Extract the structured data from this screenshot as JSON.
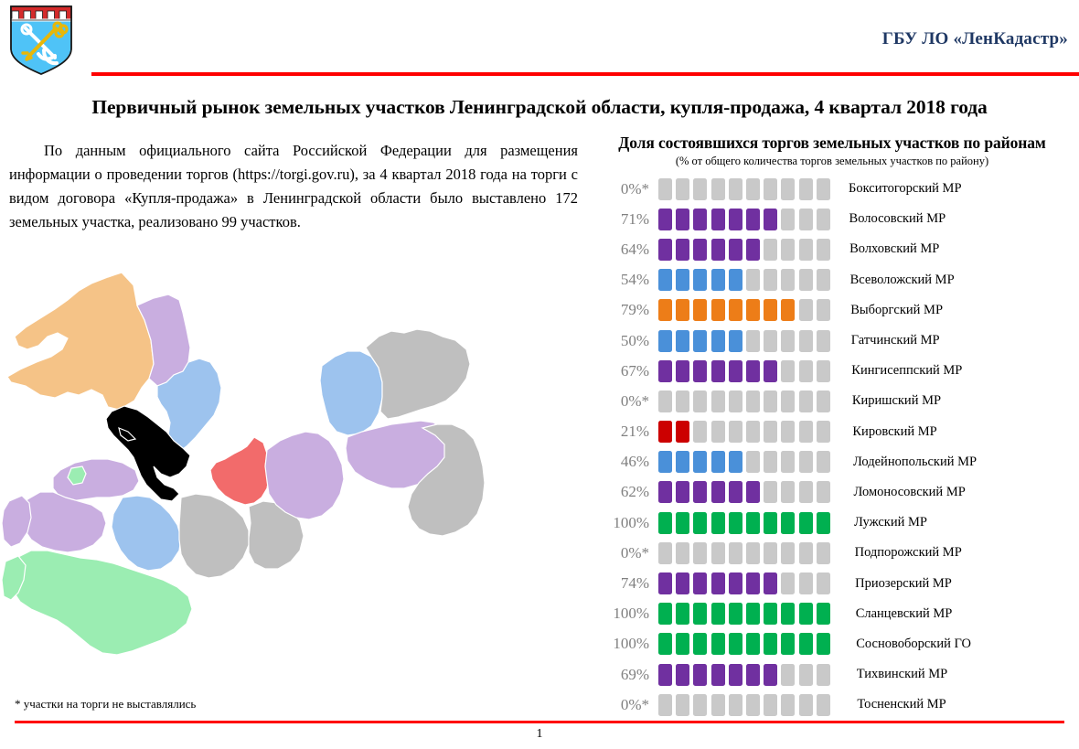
{
  "header": {
    "org_name": "ГБУ ЛО «ЛенКадастр»",
    "emblem_icon": "leningrad-oblast-coat-of-arms",
    "rule_color": "#FF0000"
  },
  "main_title": "Первичный рынок земельных участков Ленинградской области, купля-продажа, 4 квартал 2018 года",
  "intro_text": "По данным официального сайта Российской Федерации для размещения информации о проведении торгов (https://torgi.gov.ru), за 4 квартал 2018 года на торги с видом договора «Купля-продажа» в Ленинградской области было выставлено 172 земельных участка, реализовано 99 участков.",
  "footnote": "* участки на торги не выставлялись",
  "page_number": "1",
  "map": {
    "name": "leningrad-oblast-districts-map",
    "colors": {
      "orange": "#F5C387",
      "violet": "#C9AEE0",
      "blue": "#9DC3EE",
      "red": "#F26B6B",
      "green": "#9BEDB2",
      "grey": "#BFBFBF",
      "black": "#000000"
    }
  },
  "chart_data": {
    "type": "bar",
    "title": "Доля состоявшихся торгов земельных участков по районам",
    "subtitle": "(% от общего количества торгов земельных участков по району)",
    "xlabel": "",
    "ylabel": "",
    "blocks_total": 10,
    "legend_position": "none",
    "grid": false,
    "palette": {
      "purple": "#7030A0",
      "blue": "#4A90D9",
      "orange": "#ED7D18",
      "red": "#CC0000",
      "green": "#00B050",
      "empty": "#C9C9C9"
    },
    "categories": [
      "Бокситогорский МР",
      "Волосовский МР",
      "Волховский МР",
      "Всеволожский МР",
      "Выборгский МР",
      "Гатчинский МР",
      "Кингисеппский МР",
      "Киришский МР",
      "Кировский МР",
      "Лодейнопольский МР",
      "Ломоносовский МР",
      "Лужский МР",
      "Подпорожский МР",
      "Приозерский МР",
      "Сланцевский МР",
      "Сосновоборский ГО",
      "Тихвинский МР",
      "Тосненский МР"
    ],
    "values": [
      0,
      71,
      64,
      54,
      79,
      50,
      67,
      0,
      21,
      46,
      62,
      100,
      0,
      74,
      100,
      100,
      69,
      0
    ],
    "value_labels": [
      "0%*",
      "71%",
      "64%",
      "54%",
      "79%",
      "50%",
      "67%",
      "0%*",
      "21%",
      "46%",
      "62%",
      "100%",
      "0%*",
      "74%",
      "100%",
      "100%",
      "69%",
      "0%*"
    ],
    "filled_blocks": [
      0,
      7,
      6,
      5,
      8,
      5,
      7,
      0,
      2,
      5,
      6,
      10,
      0,
      7,
      10,
      10,
      7,
      0
    ],
    "colors": [
      "empty",
      "purple",
      "purple",
      "blue",
      "orange",
      "blue",
      "purple",
      "empty",
      "red",
      "blue",
      "purple",
      "green",
      "empty",
      "purple",
      "green",
      "green",
      "purple",
      "empty"
    ]
  }
}
